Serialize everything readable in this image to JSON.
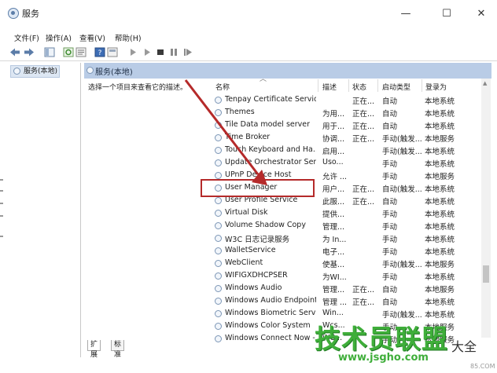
{
  "window": {
    "title": "服务",
    "minimize": "—",
    "maximize": "☐",
    "close": "✕"
  },
  "menu": [
    {
      "label": "文件(F)"
    },
    {
      "label": "操作(A)"
    },
    {
      "label": "查看(V)"
    },
    {
      "label": "帮助(H)"
    }
  ],
  "tree": {
    "item": "服务(本地)"
  },
  "panel": {
    "title": "服务(本地)",
    "description": "选择一个项目来查看它的描述。",
    "headers": {
      "name": "名称",
      "desc": "描述",
      "status": "状态",
      "startup": "启动类型",
      "logon": "登录为"
    },
    "rows": [
      {
        "name": "Tenpay Certificate Service",
        "desc": "",
        "status": "正在...",
        "startup": "自动",
        "logon": "本地系统"
      },
      {
        "name": "Themes",
        "desc": "为用...",
        "status": "正在...",
        "startup": "自动",
        "logon": "本地系统"
      },
      {
        "name": "Tile Data model server",
        "desc": "用于...",
        "status": "正在...",
        "startup": "自动",
        "logon": "本地系统"
      },
      {
        "name": "Time Broker",
        "desc": "协调...",
        "status": "正在...",
        "startup": "手动(触发...",
        "logon": "本地服务"
      },
      {
        "name": "Touch Keyboard and Ha...",
        "desc": "启用...",
        "status": "",
        "startup": "手动(触发...",
        "logon": "本地系统"
      },
      {
        "name": "Update Orchestrator Ser...",
        "desc": "Uso...",
        "status": "",
        "startup": "手动",
        "logon": "本地系统"
      },
      {
        "name": "UPnP Device Host",
        "desc": "允许 ...",
        "status": "",
        "startup": "手动",
        "logon": "本地服务"
      },
      {
        "name": "User Manager",
        "desc": "用户...",
        "status": "正在...",
        "startup": "自动(触发...",
        "logon": "本地系统"
      },
      {
        "name": "User Profile Service",
        "desc": "此服...",
        "status": "正在...",
        "startup": "自动",
        "logon": "本地系统"
      },
      {
        "name": "Virtual Disk",
        "desc": "提供...",
        "status": "",
        "startup": "手动",
        "logon": "本地系统"
      },
      {
        "name": "Volume Shadow Copy",
        "desc": "管理...",
        "status": "",
        "startup": "手动",
        "logon": "本地系统"
      },
      {
        "name": "W3C 日志记录服务",
        "desc": "为 In...",
        "status": "",
        "startup": "手动",
        "logon": "本地系统"
      },
      {
        "name": "WalletService",
        "desc": "电子...",
        "status": "",
        "startup": "手动",
        "logon": "本地系统"
      },
      {
        "name": "WebClient",
        "desc": "使基...",
        "status": "",
        "startup": "手动(触发...",
        "logon": "本地服务"
      },
      {
        "name": "WIFIGXDHCPSER",
        "desc": "为WI...",
        "status": "",
        "startup": "手动",
        "logon": "本地系统"
      },
      {
        "name": "Windows Audio",
        "desc": "管理...",
        "status": "正在...",
        "startup": "自动",
        "logon": "本地服务"
      },
      {
        "name": "Windows Audio Endpoint...",
        "desc": "管理 ...",
        "status": "正在...",
        "startup": "自动",
        "logon": "本地系统"
      },
      {
        "name": "Windows Biometric Servi...",
        "desc": "Win...",
        "status": "",
        "startup": "手动(触发...",
        "logon": "本地系统"
      },
      {
        "name": "Windows Color System",
        "desc": "Wcs...",
        "status": "",
        "startup": "手动",
        "logon": "本地服务"
      },
      {
        "name": "Windows Connect Now -...",
        "desc": "WC...",
        "status": "",
        "startup": "手动",
        "logon": "本地服务"
      }
    ]
  },
  "tabs": [
    {
      "label": "扩展"
    },
    {
      "label": "标准"
    }
  ],
  "watermark": {
    "brand": "技术员联盟",
    "small": "大全",
    "url": "www.jsgho.com",
    "url2": "85.COM"
  },
  "colors": {
    "highlight": "#b52a2a",
    "header_bg": "#b9cce6",
    "watermark": "#3fae3a"
  }
}
